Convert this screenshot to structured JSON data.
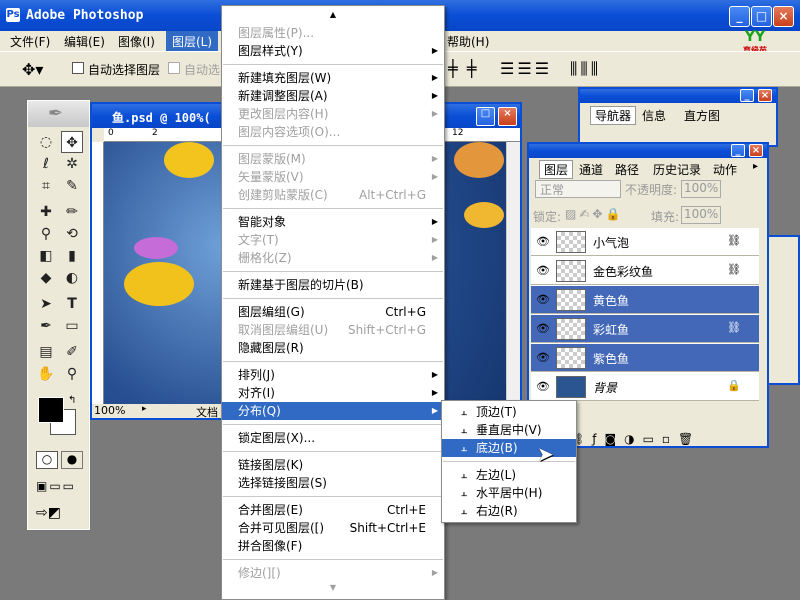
{
  "app": {
    "title": "Adobe Photoshop",
    "menubar": [
      "文件(F)",
      "编辑(E)",
      "图像(I)",
      "图层(L)",
      "帮助(H)"
    ],
    "logo_text": "育缘苑"
  },
  "options_bar": {
    "auto_select_layer": "自动选择图层",
    "auto_select_2": "自动选"
  },
  "document": {
    "title": "鱼.psd @ 100%(",
    "zoom": "100%",
    "status": "文档",
    "ruler_marks": [
      "0",
      "2",
      "12"
    ]
  },
  "navigator_panel": {
    "tabs": [
      "导航器",
      "信息",
      "直方图"
    ]
  },
  "layers_panel": {
    "tabs": [
      "图层",
      "通道",
      "路径",
      "历史记录",
      "动作"
    ],
    "blend_mode": "正常",
    "opacity_label": "不透明度:",
    "opacity_value": "100%",
    "lock_label": "锁定:",
    "fill_label": "填充:",
    "fill_value": "100%",
    "layers": [
      {
        "name": "小气泡",
        "selected": false,
        "linked": true
      },
      {
        "name": "金色彩纹鱼",
        "selected": false,
        "linked": true
      },
      {
        "name": "黄色鱼",
        "selected": true,
        "linked": false
      },
      {
        "name": "彩虹鱼",
        "selected": true,
        "linked": true
      },
      {
        "name": "紫色鱼",
        "selected": true,
        "linked": false
      },
      {
        "name": "背景",
        "selected": false,
        "linked": false,
        "locked": true
      }
    ]
  },
  "layer_menu": {
    "items": [
      {
        "label": "图层属性(P)...",
        "disabled": true
      },
      {
        "label": "图层样式(Y)",
        "submenu": true
      },
      {
        "sep": true
      },
      {
        "label": "新建填充图层(W)",
        "submenu": true
      },
      {
        "label": "新建调整图层(A)",
        "submenu": true
      },
      {
        "label": "更改图层内容(H)",
        "disabled": true,
        "submenu": true
      },
      {
        "label": "图层内容选项(O)...",
        "disabled": true
      },
      {
        "sep": true
      },
      {
        "label": "图层蒙版(M)",
        "disabled": true,
        "submenu": true
      },
      {
        "label": "矢量蒙版(V)",
        "disabled": true,
        "submenu": true
      },
      {
        "label": "创建剪贴蒙版(C)",
        "disabled": true,
        "shortcut": "Alt+Ctrl+G"
      },
      {
        "sep": true
      },
      {
        "label": "智能对象",
        "submenu": true
      },
      {
        "label": "文字(T)",
        "disabled": true,
        "submenu": true
      },
      {
        "label": "栅格化(Z)",
        "disabled": true,
        "submenu": true
      },
      {
        "sep": true
      },
      {
        "label": "新建基于图层的切片(B)"
      },
      {
        "sep": true
      },
      {
        "label": "图层编组(G)",
        "shortcut": "Ctrl+G"
      },
      {
        "label": "取消图层编组(U)",
        "disabled": true,
        "shortcut": "Shift+Ctrl+G"
      },
      {
        "label": "隐藏图层(R)"
      },
      {
        "sep": true
      },
      {
        "label": "排列(J)",
        "submenu": true
      },
      {
        "label": "对齐(I)",
        "submenu": true
      },
      {
        "label": "分布(Q)",
        "submenu": true,
        "highlighted": true
      },
      {
        "sep": true
      },
      {
        "label": "锁定图层(X)..."
      },
      {
        "sep": true
      },
      {
        "label": "链接图层(K)"
      },
      {
        "label": "选择链接图层(S)"
      },
      {
        "sep": true
      },
      {
        "label": "合并图层(E)",
        "shortcut": "Ctrl+E"
      },
      {
        "label": "合并可见图层([)",
        "shortcut": "Shift+Ctrl+E"
      },
      {
        "label": "拼合图像(F)"
      },
      {
        "sep": true
      },
      {
        "label": "修边(][)",
        "disabled": true,
        "submenu": true
      }
    ]
  },
  "distribute_submenu": {
    "items": [
      {
        "label": "顶边(T)",
        "icon": "distribute-top-icon"
      },
      {
        "label": "垂直居中(V)",
        "icon": "distribute-vcenter-icon"
      },
      {
        "label": "底边(B)",
        "icon": "distribute-bottom-icon",
        "highlighted": true
      },
      {
        "sep": true
      },
      {
        "label": "左边(L)",
        "icon": "distribute-left-icon"
      },
      {
        "label": "水平居中(H)",
        "icon": "distribute-hcenter-icon"
      },
      {
        "label": "右边(R)",
        "icon": "distribute-right-icon"
      }
    ]
  },
  "colors": {
    "accent": "#316ac5",
    "titlebar": "#0a4ed6",
    "selected_layer": "#4468b8"
  }
}
